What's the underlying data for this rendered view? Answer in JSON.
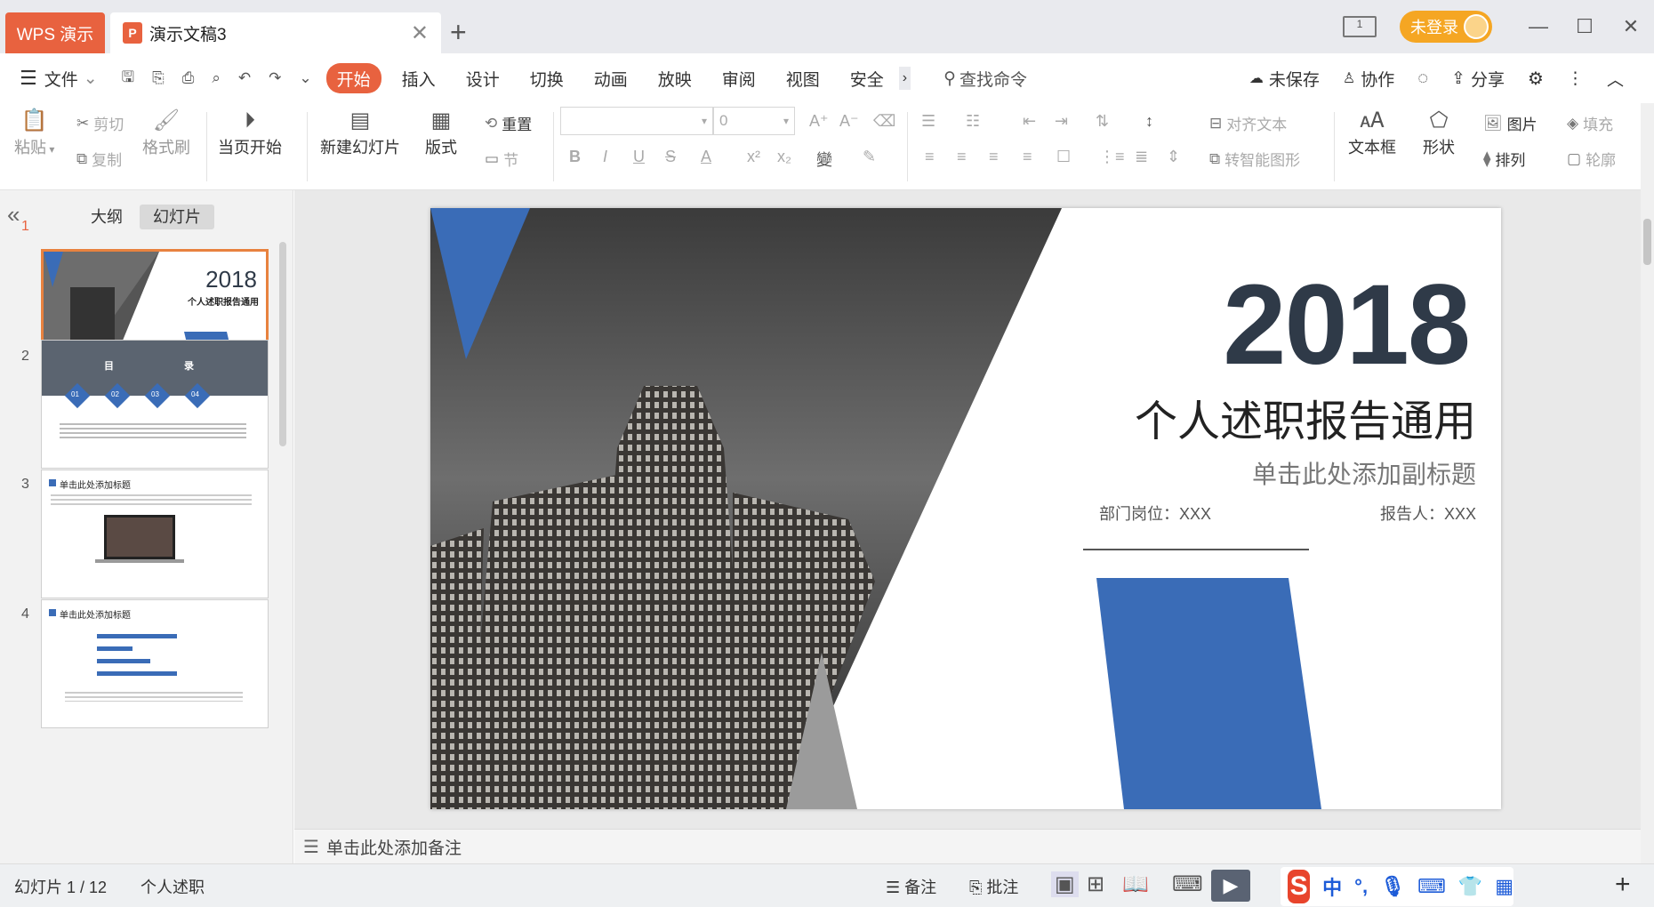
{
  "titlebar": {
    "app_tab": "WPS 演示",
    "doc_tab": "演示文稿3",
    "doc_icon": "P",
    "new_tab": "+",
    "login": "未登录",
    "monitor": "1"
  },
  "quick": {
    "file": "文件"
  },
  "menu": {
    "tabs": [
      "开始",
      "插入",
      "设计",
      "切换",
      "动画",
      "放映",
      "审阅",
      "视图",
      "安全"
    ],
    "more": "›",
    "search": "查找命令",
    "unsaved": "未保存",
    "collab": "协作",
    "share": "分享"
  },
  "ribbon": {
    "paste": "粘贴",
    "cut": "剪切",
    "copy": "复制",
    "format_painter": "格式刷",
    "play_current": "当页开始",
    "new_slide": "新建幻灯片",
    "layout": "版式",
    "reset": "重置",
    "section": "节",
    "font_size": "0",
    "align_text": "对齐文本",
    "smart_art": "转智能图形",
    "textbox": "文本框",
    "shape": "形状",
    "picture": "图片",
    "arrange": "排列",
    "fill": "填充",
    "outline": "轮廓",
    "bold": "B",
    "italic": "I",
    "underline": "U",
    "strike": "S",
    "font_color": "A"
  },
  "panel": {
    "outline_tab": "大纲",
    "slides_tab": "幻灯片",
    "numbers": [
      "1",
      "2",
      "3",
      "4"
    ]
  },
  "thumbs": {
    "t1_year": "2018",
    "t1_title": "个人述职报告通用",
    "t2_title": [
      "目",
      "录"
    ],
    "t2_items": [
      "01",
      "02",
      "03",
      "04"
    ],
    "t3_title": "单击此处添加标题",
    "t4_title": "单击此处添加标题"
  },
  "slide": {
    "year": "2018",
    "title": "个人述职报告通用",
    "subtitle": "单击此处添加副标题",
    "dept": "部门岗位：XXX",
    "reporter": "报告人：XXX"
  },
  "notes": {
    "placeholder": "单击此处添加备注"
  },
  "status": {
    "slide_counter": "幻灯片 1 / 12",
    "theme": "个人述职",
    "notes_btn": "备注",
    "comment_btn": "批注"
  },
  "ime": {
    "cn": "中",
    "punct": "°,"
  },
  "colors": {
    "accent": "#e8623f",
    "slide_blue": "#3a6cb7",
    "slide_dark": "#2f3a48"
  }
}
